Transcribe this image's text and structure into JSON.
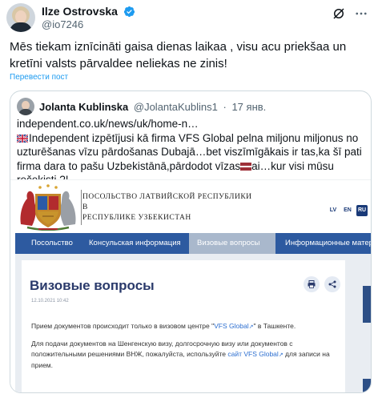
{
  "author": {
    "name": "Ilze Ostrovska",
    "handle": "@io7246"
  },
  "tweet": {
    "text": "Mēs tiekam iznīcināti gaisa dienas laikaa , visu acu priekšaa un kretīni valsts pārvaldee neliekas ne zinis!",
    "translate_label": "Перевести пост"
  },
  "quote": {
    "name": "Jolanta Kublinska",
    "handle": "@JolantaKublins1",
    "separator": "·",
    "date": "17 янв.",
    "url_line": "independent.co.uk/news/uk/home-n…",
    "text_part1": "Independent izpētījusi kā firma VFS Global pelna miljonu miljonus no uzturēšanas vīzu pārdošanas Dubajā…bet viszīmīgākais ir tas,ka šī pati firma dara to pašu Uzbekistānā,pārdodot vīzas",
    "text_part2": "ai…kur visi mūsu rečekisti ?!"
  },
  "embassy": {
    "line1": "ПОСОЛЬСТВО ЛАТВИЙСКОЙ РЕСПУБЛИКИ",
    "line2": "В",
    "line3": "РЕСПУБЛИКЕ УЗБЕКИСТАН",
    "languages": [
      "LV",
      "EN",
      "RU"
    ],
    "nav": [
      "Посольство",
      "Консульская информация",
      "Визовые вопросы",
      "Информационные материа"
    ],
    "page_title": "Визовые вопросы",
    "page_date": "12.10.2021 10:42",
    "p1_before": "Прием документов происходит только в визовом центре \"",
    "p1_link": "VFS Global",
    "p1_after": "\" в Ташкенте.",
    "p2_before": "Для подачи документов на Шенгенскую визу, долгосрочную визу или документов с положительными решениями ВНЖ, пожалуйста, используйте ",
    "p2_link": "сайт VFS Global",
    "p2_after": " для записи на прием."
  },
  "colors": {
    "accent": "#1d9bf0",
    "nav_blue": "#2d5aa0",
    "nav_active": "#a9b8cc",
    "title_blue": "#2a3a6b"
  }
}
